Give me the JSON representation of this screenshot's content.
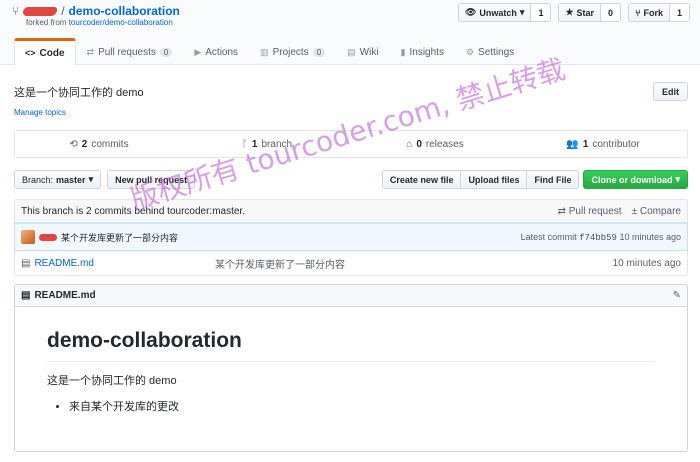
{
  "repo": {
    "name": "demo-collaboration",
    "separator": "/",
    "forked_prefix": "forked from",
    "forked_from": "tourcoder/demo-collaboration"
  },
  "actions": [
    {
      "label": "Unwatch",
      "icon": "eye-icon",
      "count": "1"
    },
    {
      "label": "Star",
      "icon": "star-icon",
      "count": "0"
    },
    {
      "label": "Fork",
      "icon": "fork-icon",
      "count": "1"
    }
  ],
  "tabs": [
    {
      "label": "Code",
      "icon": "code-icon",
      "counter": ""
    },
    {
      "label": "Pull requests",
      "icon": "pull-request-icon",
      "counter": "0"
    },
    {
      "label": "Actions",
      "icon": "play-icon",
      "counter": ""
    },
    {
      "label": "Projects",
      "icon": "project-icon",
      "counter": "0"
    },
    {
      "label": "Wiki",
      "icon": "book-icon",
      "counter": ""
    },
    {
      "label": "Insights",
      "icon": "graph-icon",
      "counter": ""
    },
    {
      "label": "Settings",
      "icon": "gear-icon",
      "counter": ""
    }
  ],
  "description": "这是一个协同工作的 demo",
  "manage_topics": "Manage topics",
  "edit_label": "Edit",
  "summary": {
    "commits_count": "2",
    "commits_label": "commits",
    "branch_count": "1",
    "branch_label": "branch",
    "releases_count": "0",
    "releases_label": "releases",
    "contributor_count": "1",
    "contributor_label": "contributor"
  },
  "file_nav": {
    "branch_prefix": "Branch:",
    "branch": "master",
    "new_pr": "New pull request",
    "create_file": "Create new file",
    "upload": "Upload files",
    "find": "Find File",
    "clone": "Clone or download"
  },
  "behind": {
    "text": "This branch is 2 commits behind tourcoder:master.",
    "pull_request": "Pull request",
    "compare": "Compare"
  },
  "commit": {
    "message": "某个开发库更新了一部分内容",
    "latest_label": "Latest commit",
    "sha": "f74bb59",
    "age": "10 minutes ago"
  },
  "files": [
    {
      "name": "README.md",
      "message": "某个开发库更新了一部分内容",
      "age": "10 minutes ago"
    }
  ],
  "readme": {
    "filename": "README.md",
    "heading": "demo-collaboration",
    "paragraph": "这是一个协同工作的 demo",
    "list": [
      "来自某个开发库的更改"
    ]
  },
  "watermark": "版权所有 tourcoder.com, 禁止转载"
}
